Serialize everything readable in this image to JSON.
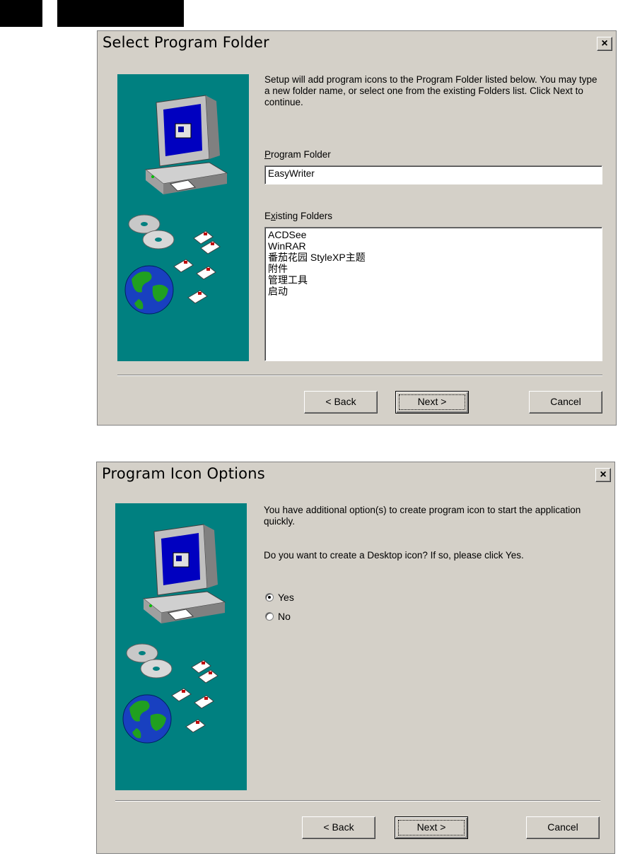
{
  "dialog1": {
    "title": "Select Program Folder",
    "close_label": "×",
    "description": "Setup will add program icons to the Program Folder listed below. You may type a new folder name, or select one from the existing Folders list. Click Next to continue.",
    "program_folder_label": "Program Folder",
    "program_folder_value": "EasyWriter",
    "existing_folders_label": "Existing Folders",
    "existing_folders": [
      "ACDSee",
      "WinRAR",
      "番茄花园 StyleXP主题",
      "附件",
      "管理工具",
      "启动"
    ],
    "buttons": {
      "back": "< Back",
      "next": "Next >",
      "cancel": "Cancel"
    }
  },
  "dialog2": {
    "title": "Program Icon Options",
    "close_label": "×",
    "description": "You have additional option(s) to create program icon to start the application quickly.",
    "question": "Do you want to create a Desktop icon? If so, please click Yes.",
    "options": [
      {
        "label": "Yes",
        "selected": true
      },
      {
        "label": "No",
        "selected": false
      }
    ],
    "buttons": {
      "back": "< Back",
      "next": "Next >",
      "cancel": "Cancel"
    }
  },
  "colors": {
    "panel": "#008080",
    "dialog_bg": "#d4d0c8"
  }
}
